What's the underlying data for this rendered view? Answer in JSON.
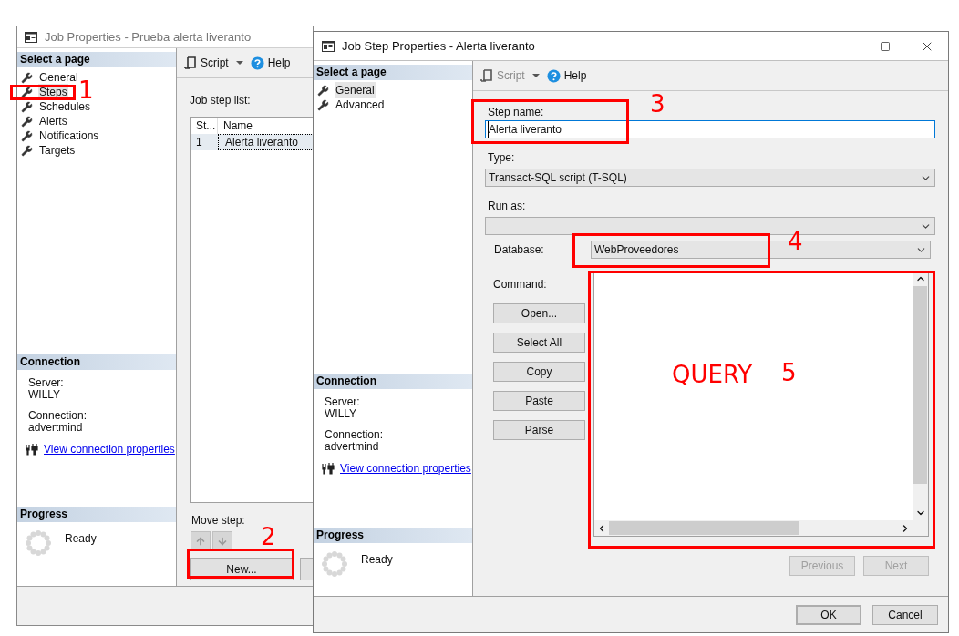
{
  "job_window": {
    "title": "Job Properties - Prueba alerta liveranto",
    "select_page_header": "Select a page",
    "pages": [
      {
        "label": "General",
        "selected": false
      },
      {
        "label": "Steps",
        "selected": true
      },
      {
        "label": "Schedules",
        "selected": false
      },
      {
        "label": "Alerts",
        "selected": false
      },
      {
        "label": "Notifications",
        "selected": false
      },
      {
        "label": "Targets",
        "selected": false
      }
    ],
    "connection_header": "Connection",
    "connection": {
      "server_label": "Server:",
      "server": "WILLY",
      "connection_label": "Connection:",
      "connection": "advertmind",
      "link": "View connection properties"
    },
    "progress_header": "Progress",
    "progress_status": "Ready",
    "toolbar": [
      {
        "kind": "script",
        "label": "Script",
        "disabled": false
      },
      {
        "kind": "help",
        "label": "Help",
        "disabled": false
      }
    ],
    "step_list_label": "Job step list:",
    "step_table": {
      "columns": [
        "St...",
        "Name"
      ],
      "rows": [
        {
          "cells": [
            "1",
            "Alerta liveranto"
          ],
          "selected": true
        }
      ]
    },
    "move_step_label": "Move step:",
    "new_button": "New..."
  },
  "step_window": {
    "title": "Job Step Properties - Alerta liveranto",
    "select_page_header": "Select a page",
    "pages": [
      {
        "label": "General",
        "selected": true
      },
      {
        "label": "Advanced",
        "selected": false
      }
    ],
    "connection_header": "Connection",
    "connection": {
      "server_label": "Server:",
      "server": "WILLY",
      "connection_label": "Connection:",
      "connection": "advertmind",
      "link": "View connection properties"
    },
    "progress_header": "Progress",
    "progress_status": "Ready",
    "toolbar": [
      {
        "kind": "script",
        "label": "Script",
        "disabled": true
      },
      {
        "kind": "help",
        "label": "Help",
        "disabled": false
      }
    ],
    "form": {
      "step_name_label": "Step name:",
      "step_name_value": "Alerta liveranto",
      "type_label": "Type:",
      "type_value": "Transact-SQL script (T-SQL)",
      "run_as_label": "Run as:",
      "database_label": "Database:",
      "database_value": "WebProveedores",
      "command_label": "Command:",
      "command_buttons": [
        "Open...",
        "Select All",
        "Copy",
        "Paste",
        "Parse"
      ]
    },
    "nav_buttons": [
      {
        "label": "Previous",
        "disabled": true
      },
      {
        "label": "Next",
        "disabled": true
      }
    ],
    "dialog_buttons": [
      {
        "label": "OK",
        "default": true
      },
      {
        "label": "Cancel",
        "default": false
      }
    ]
  },
  "annotations": [
    {
      "number": "1"
    },
    {
      "number": "2"
    },
    {
      "number": "3"
    },
    {
      "number": "4"
    },
    {
      "number": "5",
      "caption": "QUERY"
    }
  ]
}
